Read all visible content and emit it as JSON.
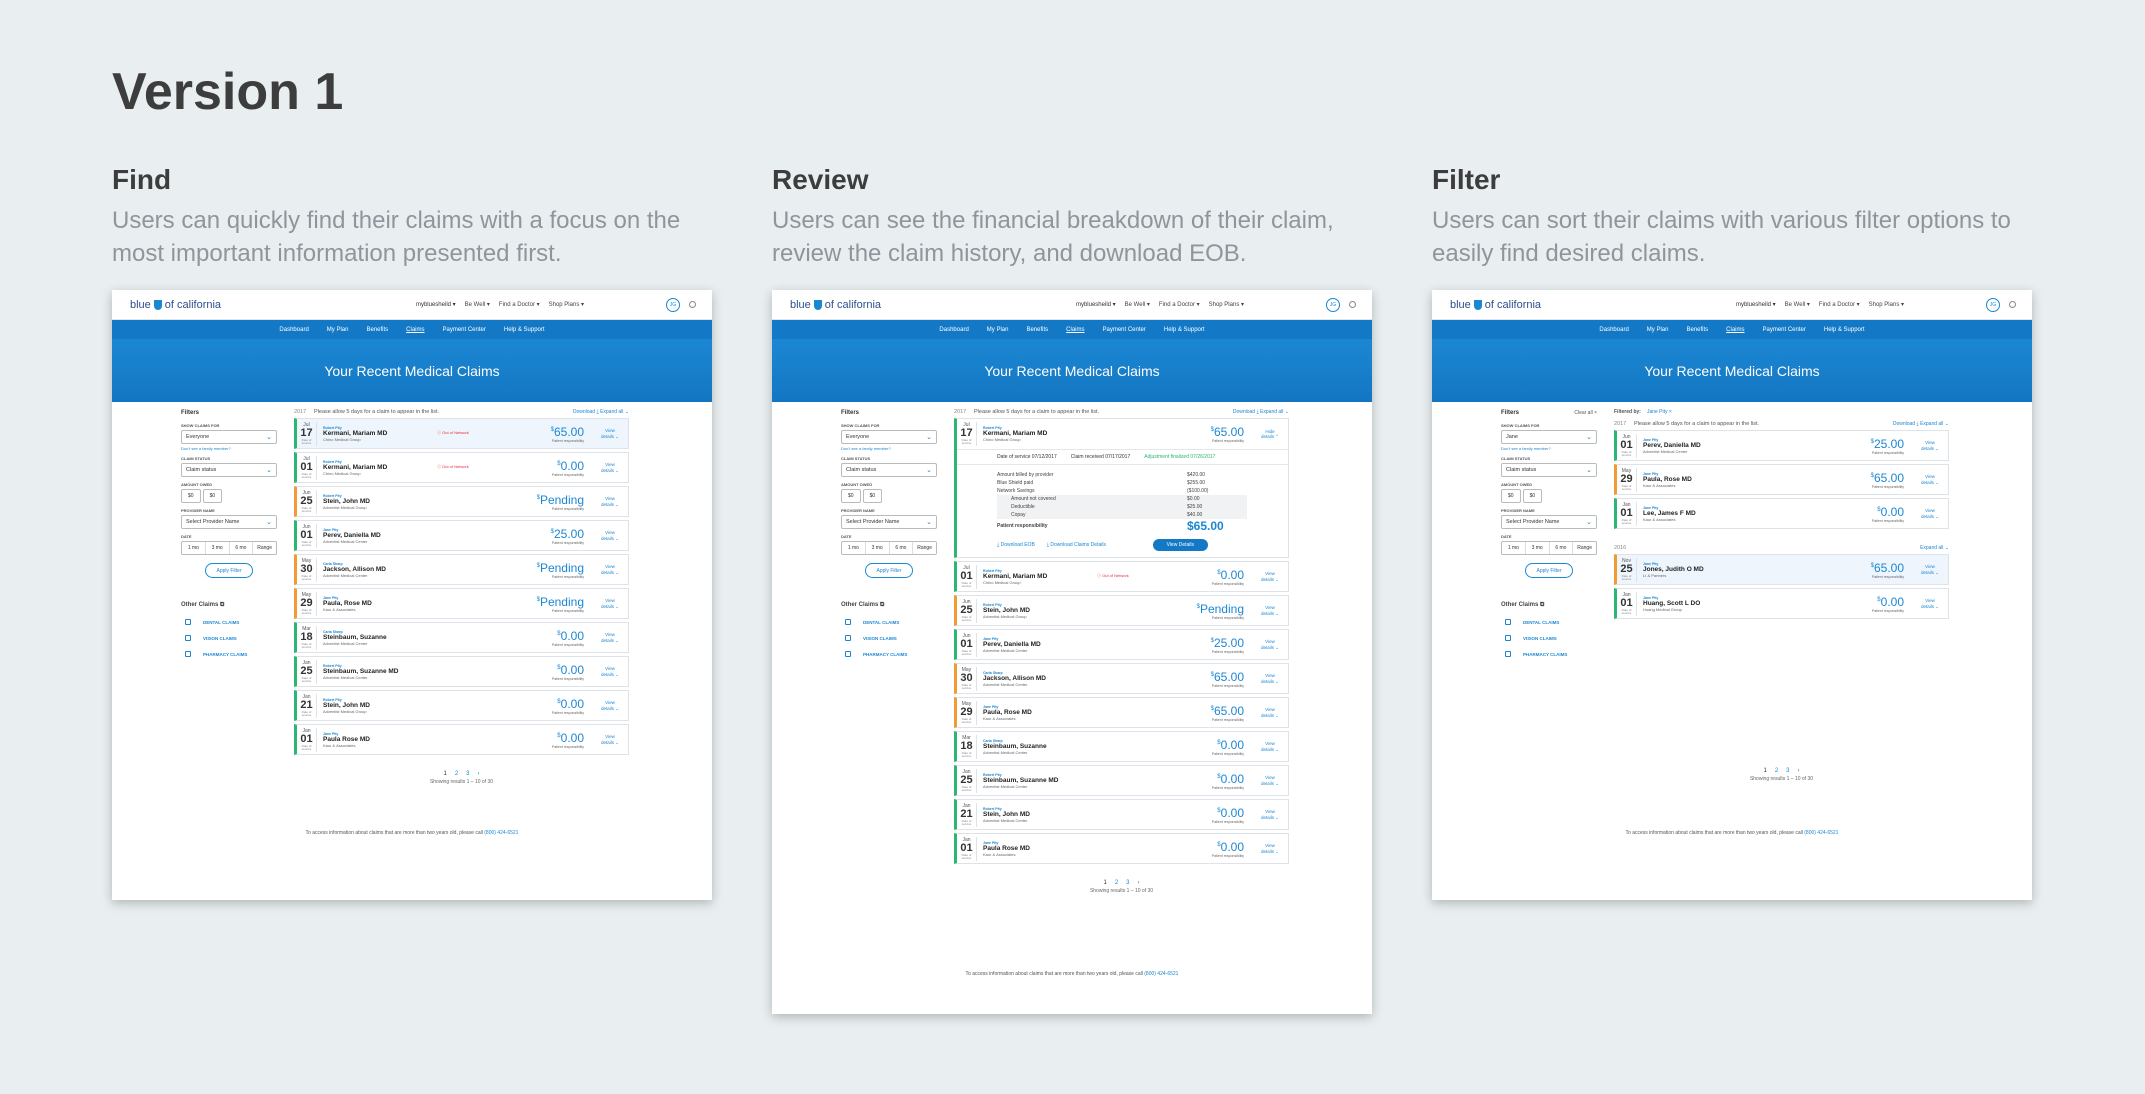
{
  "page_title": "Version 1",
  "sections": [
    {
      "title": "Find",
      "desc": "Users can quickly find their claims with a focus on the most important information presented first."
    },
    {
      "title": "Review",
      "desc": "Users can see the financial breakdown of their claim, review the claim history, and download EOB."
    },
    {
      "title": "Filter",
      "desc": "Users can sort their claims with various filter options to easily find desired claims."
    }
  ],
  "app": {
    "logo": "blue of california",
    "nav": [
      "mybluesheild",
      "Be Well",
      "Find a Doctor",
      "Shop Plans"
    ],
    "avatar": "JG",
    "subnav": [
      "Dashboard",
      "My Plan",
      "Benefits",
      "Claims",
      "Payment Center",
      "Help & Support"
    ],
    "hero": "Your Recent Medical Claims",
    "filters": {
      "title": "Filters",
      "show_label": "Show claims for",
      "show_value": "Everyone",
      "show_value_filter": "Jane",
      "hint": "Don't see a family member?",
      "status_label": "Claim status",
      "status_value": "Claim status",
      "amount_label": "Amount owed",
      "amount_from": "$0",
      "amount_to": "$0",
      "provider_label": "Provider name",
      "provider_value": "Select Provider Name",
      "date_label": "Date",
      "ranges": [
        "1 mo",
        "3 mo",
        "6 mo",
        "Range"
      ],
      "apply": "Apply Filter",
      "clear": "Clear all",
      "other": "Other Claims",
      "other_links": [
        "DENTAL CLAIMS",
        "VISION CLAIMS",
        "PHARMACY CLAIMS"
      ]
    },
    "list": {
      "year": "2017",
      "notice": "Please allow 5 days for a claim to appear in the list.",
      "download": "Download",
      "expand": "Expand all",
      "filtered_by": "Filtered by:",
      "filtered_value": "Jane Pity",
      "year2": "2016",
      "pages": [
        "1",
        "2",
        "3",
        "›"
      ],
      "showing": "Showing results 1 – 10 of 30",
      "footer": "To access information about claims that are more than two years old, please call",
      "phone": "(800) 424-6521",
      "responsibility": "Patient responsibility",
      "view": "View details",
      "hide": "Hide details",
      "oon": "Out of Network",
      "date_of_service": "Date of service"
    },
    "claims": [
      {
        "m": "Jul",
        "d": "17",
        "patient": "Robert Pity",
        "doctor": "Kermani, Mariam MD",
        "org": "Chino Medical Group",
        "amount": "65.00",
        "oon": true,
        "color": "green",
        "hl": true
      },
      {
        "m": "Jul",
        "d": "01",
        "patient": "Robert Pity",
        "doctor": "Kermani, Mariam MD",
        "org": "Chino Medical Group",
        "amount": "0.00",
        "oon": true,
        "color": "green"
      },
      {
        "m": "Jun",
        "d": "25",
        "patient": "Robert Pity",
        "doctor": "Stein, John MD",
        "org": "Adventist Medical Group",
        "amount": "Pending",
        "color": "orange"
      },
      {
        "m": "Jun",
        "d": "01",
        "patient": "Jane Pity",
        "doctor": "Perev, Daniella MD",
        "org": "Adventist Medical Center",
        "amount": "25.00",
        "color": "green"
      },
      {
        "m": "May",
        "d": "30",
        "patient": "Carla Sharp",
        "doctor": "Jackson, Allison MD",
        "org": "Adventist Medical Center",
        "amount": "Pending",
        "color": "orange"
      },
      {
        "m": "May",
        "d": "29",
        "patient": "Jane Pity",
        "doctor": "Paula, Rose MD",
        "org": "Kaur & Associates",
        "amount": "Pending",
        "color": "orange"
      },
      {
        "m": "Mar",
        "d": "18",
        "patient": "Carla Sharp",
        "doctor": "Steinbaum, Suzanne",
        "org": "Adventist Medical Center",
        "amount": "0.00",
        "color": "green"
      },
      {
        "m": "Jan",
        "d": "25",
        "patient": "Robert Pity",
        "doctor": "Steinbaum, Suzanne MD",
        "org": "Adventist Medical Center",
        "amount": "0.00",
        "color": "green"
      },
      {
        "m": "Jan",
        "d": "21",
        "patient": "Robert Pity",
        "doctor": "Stein, John MD",
        "org": "Adventist Medical Group",
        "amount": "0.00",
        "color": "green"
      },
      {
        "m": "Jan",
        "d": "01",
        "patient": "Jane Pity",
        "doctor": "Paula Rose MD",
        "org": "Kaur & Associates",
        "amount": "0.00",
        "color": "green"
      }
    ],
    "review_claims": [
      {
        "m": "Jul",
        "d": "01",
        "patient": "Robert Pity",
        "doctor": "Kermani, Mariam MD",
        "org": "Chino Medical Group",
        "amount": "0.00",
        "oon": true,
        "color": "green"
      },
      {
        "m": "Jun",
        "d": "25",
        "patient": "Robert Pity",
        "doctor": "Stein, John MD",
        "org": "Adventist Medical Group",
        "amount": "Pending",
        "color": "orange"
      },
      {
        "m": "Jun",
        "d": "01",
        "patient": "Jane Pity",
        "doctor": "Perev, Daniella MD",
        "org": "Adventist Medical Center",
        "amount": "25.00",
        "color": "green"
      },
      {
        "m": "May",
        "d": "30",
        "patient": "Carla Sharp",
        "doctor": "Jackson, Allison MD",
        "org": "Adventist Medical Center",
        "amount": "65.00",
        "color": "orange"
      },
      {
        "m": "May",
        "d": "29",
        "patient": "Jane Pity",
        "doctor": "Paula, Rose MD",
        "org": "Kaur & Associates",
        "amount": "65.00",
        "color": "orange"
      },
      {
        "m": "Mar",
        "d": "18",
        "patient": "Carla Sharp",
        "doctor": "Steinbaum, Suzanne",
        "org": "Adventist Medical Center",
        "amount": "0.00",
        "color": "green"
      },
      {
        "m": "Jan",
        "d": "25",
        "patient": "Robert Pity",
        "doctor": "Steinbaum, Suzanne MD",
        "org": "Adventist Medical Center",
        "amount": "0.00",
        "color": "green"
      },
      {
        "m": "Jan",
        "d": "21",
        "patient": "Robert Pity",
        "doctor": "Stein, John MD",
        "org": "Adventist Medical Center",
        "amount": "0.00",
        "color": "green"
      },
      {
        "m": "Jan",
        "d": "01",
        "patient": "Jane Pity",
        "doctor": "Paula Rose MD",
        "org": "Kaur & Associates",
        "amount": "0.00",
        "color": "green"
      }
    ],
    "review_expanded": {
      "m": "Jul",
      "d": "17",
      "patient": "Robert Pity",
      "doctor": "Kermani, Mariam MD",
      "org": "Chino Medical Group",
      "amount": "65.00",
      "service_label": "Date of service",
      "service_date": "07/12/2017",
      "received_label": "Claim received",
      "received_date": "07/17/2017",
      "final_label": "Adjustment finalized",
      "final_date": "07/26/2017",
      "rows": [
        {
          "k": "Amount billed by provider",
          "v": "$420.00"
        },
        {
          "k": "Blue Shield paid",
          "v": "$255.00"
        },
        {
          "k": "Network Savings",
          "v": "($100.00)"
        },
        {
          "k": "Amount not covered",
          "v": "$0.00",
          "sub": true
        },
        {
          "k": "Deductible",
          "v": "$25.00",
          "sub": true
        },
        {
          "k": "Copay",
          "v": "$40.00",
          "sub": true
        }
      ],
      "resp_label": "Patient responsibility",
      "download_eob": "Download EOB",
      "download_details": "Download Claims Details",
      "view_details": "View Details"
    },
    "filter_claims_2017": [
      {
        "m": "Jun",
        "d": "01",
        "patient": "Jane Pity",
        "doctor": "Perev, Daniella MD",
        "org": "Adventist Medical Center",
        "amount": "25.00",
        "color": "green"
      },
      {
        "m": "May",
        "d": "29",
        "patient": "Jane Pity",
        "doctor": "Paula, Rose MD",
        "org": "Kaur & Associates",
        "amount": "65.00",
        "color": "orange"
      },
      {
        "m": "Jan",
        "d": "01",
        "patient": "Jane Pity",
        "doctor": "Lee, James F MD",
        "org": "Kaur & Associates",
        "amount": "0.00",
        "color": "green"
      }
    ],
    "filter_claims_2016": [
      {
        "m": "Nov",
        "d": "25",
        "patient": "Jane Pity",
        "doctor": "Jones, Judith O MD",
        "org": "LI & Partners",
        "amount": "65.00",
        "color": "orange",
        "hl": true
      },
      {
        "m": "Jan",
        "d": "01",
        "patient": "Jane Pity",
        "doctor": "Huang, Scott L DO",
        "org": "Huang Medical Group",
        "amount": "0.00",
        "color": "green"
      }
    ]
  }
}
